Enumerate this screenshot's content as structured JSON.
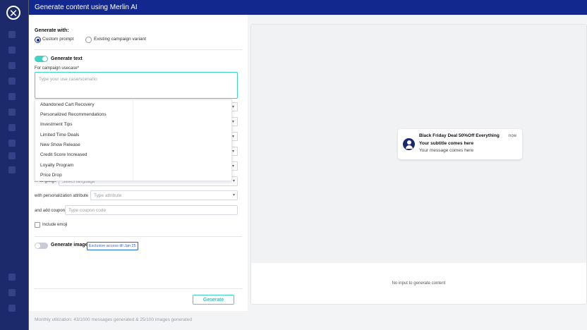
{
  "modal": {
    "title": "Generate content using Merlin AI"
  },
  "generate_with": {
    "label": "Generate with:",
    "options": [
      "Custom prompt",
      "Existing campaign variant"
    ],
    "selected": "Custom prompt"
  },
  "generate_text": {
    "label": "Generate text",
    "enabled": true,
    "usecase_label": "For campaign usecase*",
    "usecase_placeholder": "Type your use case/scenario",
    "suggestions": [
      "Abandoned Cart Recovery",
      "Personalized Recommendations",
      "Investment Tips",
      "Limited Time Deals",
      "New Show Release",
      "Credit Score Increased",
      "Loyalty Program",
      "Price Drop"
    ],
    "language_label": "in language",
    "language_placeholder": "Select language",
    "attribute_label": "with personalization attribute",
    "attribute_placeholder": "Type attribute",
    "coupon_label": "and add coupon",
    "coupon_placeholder": "Type coupon code",
    "emoji_label": "Include emoji"
  },
  "generate_image": {
    "label": "Generate image",
    "enabled": false,
    "badge": "Exclusive access till Jan 25"
  },
  "actions": {
    "generate_label": "Generate"
  },
  "footer": {
    "utilization": "Monthly utilization: 43/1000 messages generated & 25/100 images generated"
  },
  "preview": {
    "title": "Black Friday Deal 50%Off Everything",
    "time": "now",
    "subtitle": "Your subtitle comes here",
    "message": "Your message comes here",
    "empty_state": "No input to generate content"
  },
  "icons": {
    "close": "close-icon",
    "chevron": "chevron-down-icon",
    "avatar": "user-avatar-icon"
  },
  "colors": {
    "header": "#13288f",
    "sidebar": "#1c2a6b",
    "accent": "#3ed3c5",
    "badge": "#1e6bd6"
  }
}
